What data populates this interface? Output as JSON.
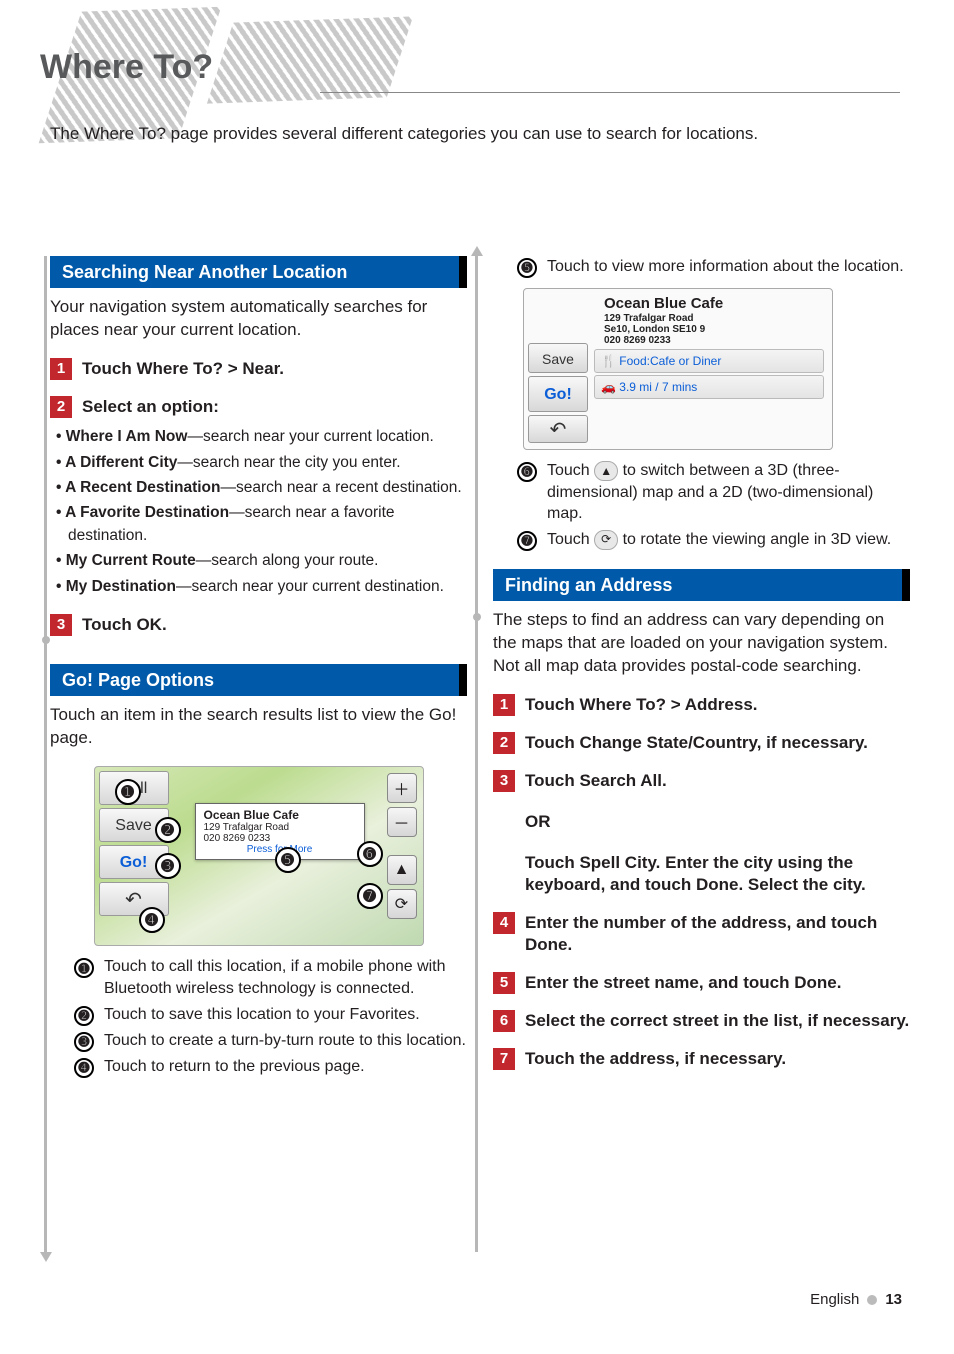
{
  "title": "Where To?",
  "intro": "The Where To? page provides several different categories you can use to search for locations.",
  "left": {
    "section1": {
      "heading": "Searching Near Another Location",
      "lead": "Your navigation system automatically searches for places near your current location.",
      "step1": "Touch Where To? > Near.",
      "step2": "Select an option:",
      "options": [
        {
          "b": "Where I Am Now",
          "t": "—search near your current location."
        },
        {
          "b": "A Different City",
          "t": "—search near the city you enter."
        },
        {
          "b": "A Recent Destination",
          "t": "—search near a recent destination."
        },
        {
          "b": "A Favorite Destination",
          "t": "—search near a favorite destination."
        },
        {
          "b": "My Current Route",
          "t": "—search along your route."
        },
        {
          "b": "My Destination",
          "t": "—search near your current destination."
        }
      ],
      "step3": "Touch OK."
    },
    "section2": {
      "heading": "Go! Page Options",
      "lead": "Touch an item in the search results list to view the Go! page.",
      "ss_buttons": {
        "call": "Call",
        "save": "Save",
        "go": "Go!"
      },
      "popup": {
        "title": "Ocean Blue Cafe",
        "addr": "129 Trafalgar Road",
        "phone": "020 8269 0233",
        "more": "Press for More"
      },
      "legend": {
        "l1": "Touch to call this location, if a mobile phone with Bluetooth wireless technology is connected.",
        "l2": "Touch to save this location to your Favorites.",
        "l3": "Touch to create a turn-by-turn route to this location.",
        "l4": "Touch to return to the previous page."
      }
    }
  },
  "right": {
    "cont": {
      "l5": "Touch to view more information about the location.",
      "ss2": {
        "title": "Ocean Blue Cafe",
        "addr1": "129 Trafalgar Road",
        "addr2": "Se10, London SE10 9",
        "phone": "020 8269 0233",
        "row1": "Food:Cafe or Diner",
        "row2": "3.9 mi /  7 mins",
        "save": "Save",
        "go": "Go!"
      },
      "l6a": "Touch ",
      "l6b": " to switch between a 3D (three-dimensional) map and a 2D (two-dimensional) map.",
      "l7a": "Touch ",
      "l7b": " to rotate the viewing angle in 3D view."
    },
    "section3": {
      "heading": "Finding an Address",
      "lead": "The steps to find an address can vary depending on the maps that are loaded on your navigation system. Not all map data provides postal-code searching.",
      "s1": "Touch Where To? > Address.",
      "s2": "Touch Change State/Country, if necessary.",
      "s3": "Touch Search All.",
      "or": "OR",
      "s3b": "Touch Spell City. Enter the city using the keyboard, and touch Done. Select the city.",
      "s4": "Enter the number of the address, and touch Done.",
      "s5": "Enter the street name, and touch Done.",
      "s6": "Select the correct street in the list, if necessary.",
      "s7": "Touch the address, if necessary."
    }
  },
  "footer": {
    "lang": "English",
    "page": "13"
  }
}
